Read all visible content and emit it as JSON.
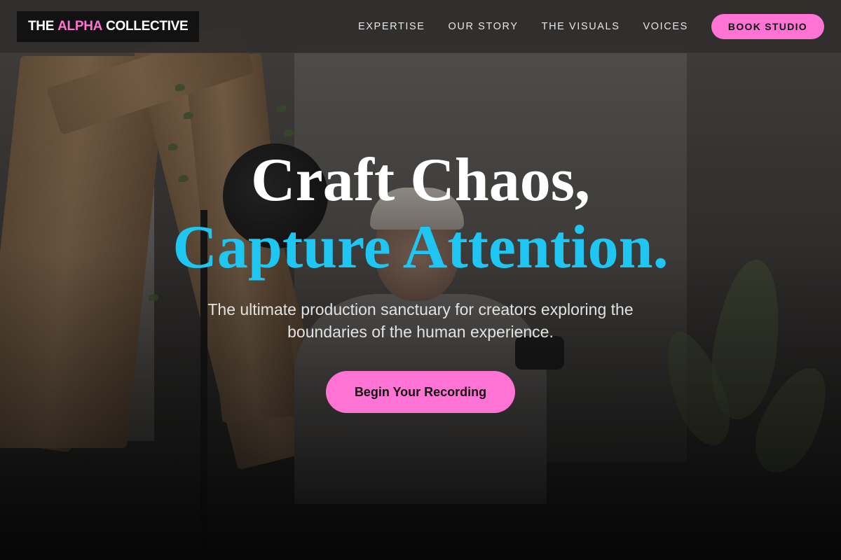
{
  "brand": {
    "part1": "THE",
    "part2": "ALPHA",
    "part3": "COLLECTIVE",
    "accent_color": "#ff73d4"
  },
  "nav": {
    "items": [
      {
        "label": "EXPERTISE"
      },
      {
        "label": "OUR STORY"
      },
      {
        "label": "THE VISUALS"
      },
      {
        "label": "VOICES"
      }
    ],
    "cta_label": "BOOK STUDIO"
  },
  "hero": {
    "headline_line1": "Craft Chaos,",
    "headline_line2": "Capture Attention.",
    "headline_accent_color": "#1fc6f2",
    "subtext": "The ultimate production sanctuary for creators exploring the boundaries of the human experience.",
    "cta_label": "Begin Your Recording"
  },
  "background": {
    "description_icon": "studio-photo-icon"
  }
}
